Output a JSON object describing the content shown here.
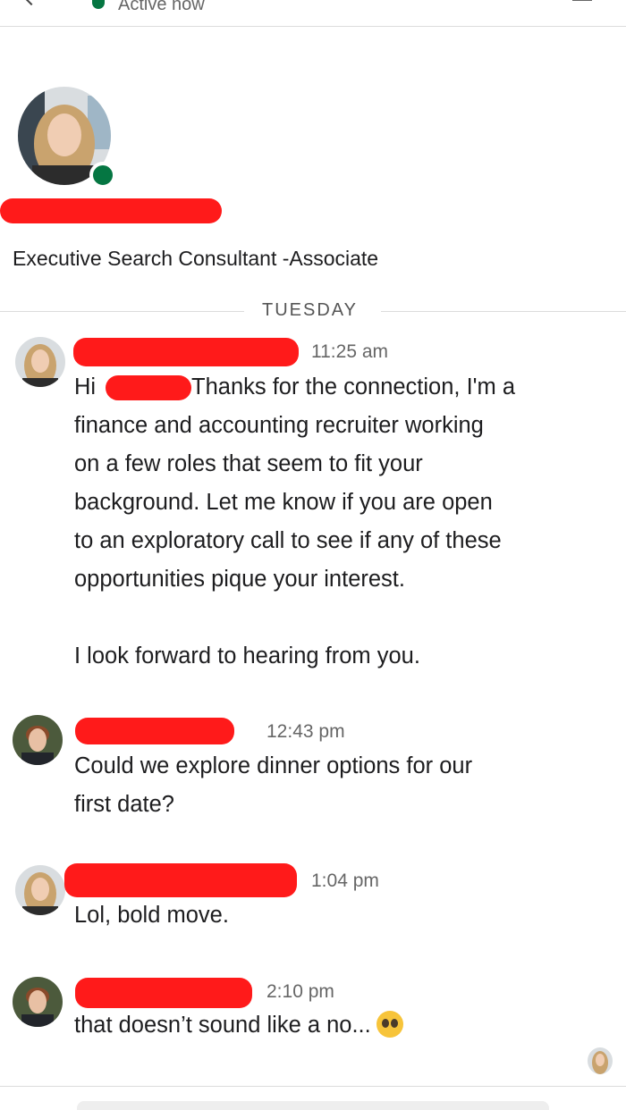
{
  "header": {
    "status": "Active now"
  },
  "profile": {
    "headline": "Executive Search Consultant -Associate"
  },
  "conversation": {
    "day_label": "TUESDAY",
    "messages": [
      {
        "time": "11:25 am",
        "lines": [
          "Hi",
          "Thanks for the connection, I'm a",
          "finance and accounting recruiter working",
          "on a few roles that seem to fit your",
          "background. Let me know if you are open",
          "to an exploratory call to see if any of these",
          "opportunities pique your interest.",
          "I look forward to hearing from you."
        ]
      },
      {
        "time": "12:43 pm",
        "lines": [
          "Could we explore dinner options for our",
          "first date?"
        ]
      },
      {
        "time": "1:04 pm",
        "lines": [
          "Lol, bold move."
        ]
      },
      {
        "time": "2:10 pm",
        "lines": [
          "that doesn’t sound like a no..."
        ]
      }
    ]
  },
  "colors": {
    "presence": "#057642",
    "redaction": "#ff1a1a",
    "divider": "#dcdcdc",
    "meta_text": "#666666"
  },
  "icons": {
    "emoji": "pleading-face-emoji",
    "back": "chevron-left-icon",
    "menu": "menu-icon"
  }
}
